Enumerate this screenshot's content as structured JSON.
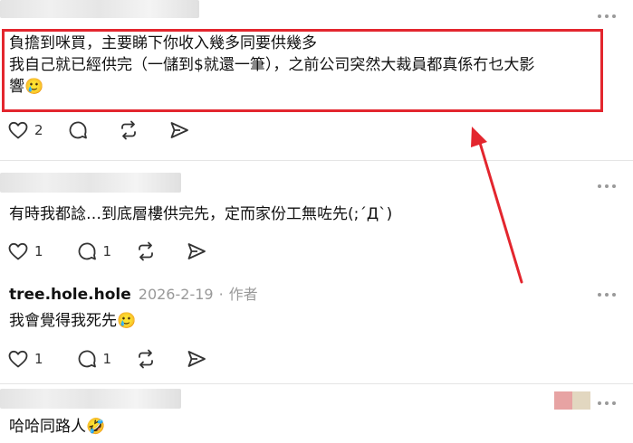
{
  "posts": [
    {
      "lines": [
        "負擔到咪買，主要睇下你收入幾多同要供幾多",
        "我自己就已經供完（一儲到$就還一筆），之前公司突然大裁員都真係冇乜大影",
        "響🥲"
      ],
      "like_count": "2",
      "comment_count": ""
    },
    {
      "lines": [
        "有時我都諗…到底層樓供完先，定而家份工無咗先(;´Д`)"
      ],
      "like_count": "1",
      "comment_count": "1"
    },
    {
      "username": "tree.hole.hole",
      "date": "2026-2-19",
      "separator": "·",
      "role": "作者",
      "lines": [
        "我會覺得我死先🥲"
      ],
      "like_count": "1",
      "comment_count": "1"
    },
    {
      "lines": [
        "哈哈同路人🤣"
      ]
    }
  ],
  "colors": {
    "annotation": "#e3262e",
    "icon": "#333333",
    "divider": "#e5e5e5"
  },
  "icons": [
    "heart-icon",
    "comment-bubble-icon",
    "repost-icon",
    "send-icon",
    "more-icon"
  ]
}
